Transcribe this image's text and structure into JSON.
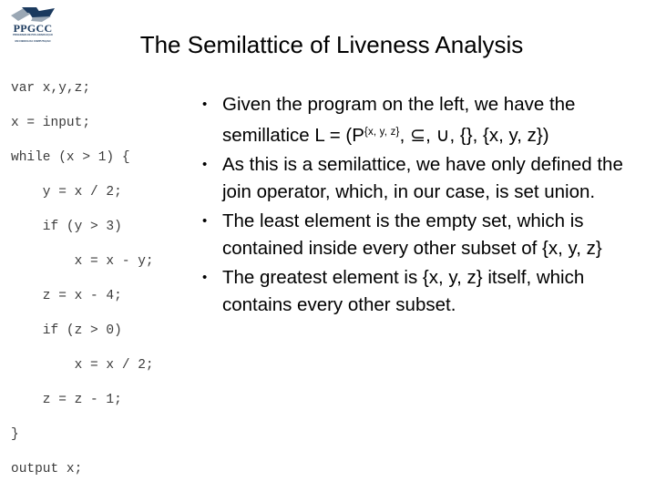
{
  "slide": {
    "title": "The Semilattice of Liveness Analysis"
  },
  "logo": {
    "wordmark": "PPGCC",
    "subtitle_line1": "PROGRAMA DE PÓS-GRADUAÇÃO",
    "subtitle_line2": "EM CIÊNCIA DA COMPUTAÇÃO",
    "mark_color_dark": "#1b3a5e",
    "mark_color_light": "#9aa7b4"
  },
  "code": {
    "lines": [
      "var x,y,z;",
      "x = input;",
      "while (x > 1) {",
      "    y = x / 2;",
      "    if (y > 3)",
      "        x = x - y;",
      "    z = x - 4;",
      "    if (z > 0)",
      "        x = x / 2;",
      "    z = z - 1;",
      "}",
      "output x;"
    ]
  },
  "bullets": [
    {
      "marker": "•",
      "part1": "Given the program on the left, we have the semillatice L = (P",
      "sup": "{x, y, z}",
      "part2": ", ⊆, ∪, {}, {x, y, z})"
    },
    {
      "marker": "•",
      "text": "As this is a semilattice, we have only defined the join operator, which, in our case, is set union."
    },
    {
      "marker": "•",
      "text": "The least element is the empty set, which is contained inside every other subset of {x, y, z}"
    },
    {
      "marker": "•",
      "text": "The greatest element is {x, y, z} itself, which contains every other subset."
    }
  ]
}
